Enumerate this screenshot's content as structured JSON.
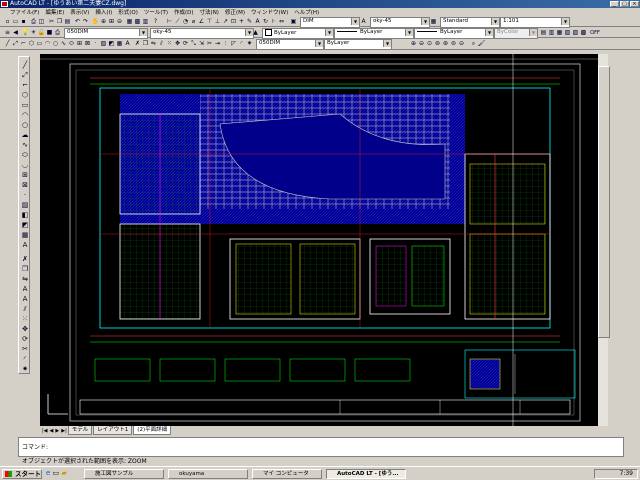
{
  "window": {
    "title": "AutoCAD LT - [ゆうあい第二夫妻CZ.dwg]",
    "min": "_",
    "max": "□",
    "close": "×"
  },
  "menu": [
    "ファイル(F)",
    "編集(E)",
    "表示(V)",
    "挿入(I)",
    "形式(O)",
    "ツール(T)",
    "作成(D)",
    "寸法(N)",
    "修正(M)",
    "ウィンドウ(W)",
    "ヘルプ(H)"
  ],
  "toolbar": {
    "dim_style": "DIM",
    "text_style": "oky-45",
    "table_style": "Standard",
    "scale": "1:101",
    "layer": "050DIM",
    "layer2": "oky-45",
    "color": "ByLayer",
    "linetype": "ByLayer",
    "lineweight": "ByLayer",
    "plotstyle": "ByColor",
    "off_label": "OFF"
  },
  "tabs": {
    "model": "モデル",
    "layout": "レイアウト1",
    "layout2": "(2)平面詳細"
  },
  "command": {
    "prompt": "コマンド:"
  },
  "status": {
    "message": "オブジェクトが選択された範囲を表示: ZOOM"
  },
  "taskbar": {
    "start": "スタート",
    "tasks": [
      "施工図サンプル",
      "okuyama",
      "マイ コンピュータ",
      "AutoCAD LT - [ゆう..."
    ],
    "clock": "7:39"
  },
  "colors": {
    "canvas": "#000000",
    "titlebar": "#0a246a"
  }
}
